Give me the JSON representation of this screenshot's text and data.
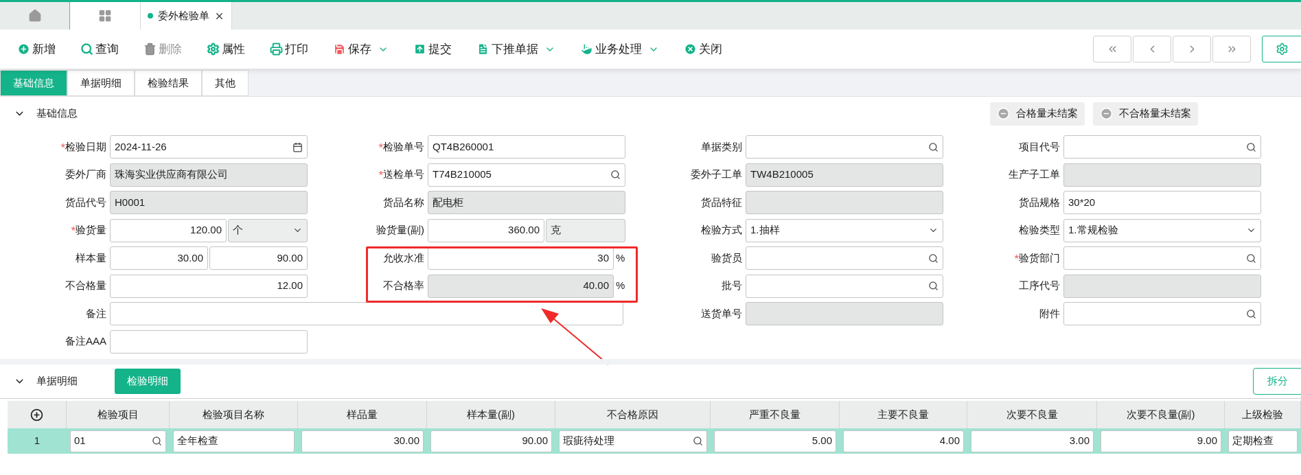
{
  "window_tabs": [
    {
      "kind": "home",
      "selected": false
    },
    {
      "kind": "apps",
      "selected": false
    },
    {
      "kind": "document",
      "label": "委外检验单",
      "selected": true
    }
  ],
  "toolbar": [
    {
      "kind": "add",
      "label": "新增",
      "disabled": false,
      "has_menu": false
    },
    {
      "kind": "query",
      "label": "查询",
      "disabled": false,
      "has_menu": false
    },
    {
      "kind": "delete",
      "label": "删除",
      "disabled": true,
      "has_menu": false
    },
    {
      "kind": "properties",
      "label": "属性",
      "disabled": false,
      "has_menu": false
    },
    {
      "kind": "print",
      "label": "打印",
      "disabled": false,
      "has_menu": false
    },
    {
      "kind": "save",
      "label": "保存",
      "disabled": false,
      "has_menu": true
    },
    {
      "kind": "submit",
      "label": "提交",
      "disabled": false,
      "has_menu": false
    },
    {
      "kind": "push",
      "label": "下推单据",
      "disabled": false,
      "has_menu": true
    },
    {
      "kind": "process",
      "label": "业务处理",
      "disabled": false,
      "has_menu": true
    },
    {
      "kind": "close",
      "label": "关闭",
      "disabled": false,
      "has_menu": false
    }
  ],
  "sub_tabs": [
    {
      "label": "基础信息",
      "selected": true
    },
    {
      "label": "单据明细",
      "selected": false
    },
    {
      "label": "检验结果",
      "selected": false
    },
    {
      "label": "其他",
      "selected": false
    }
  ],
  "basic_section": {
    "title": "基础信息",
    "expanded": true,
    "status_buttons": [
      "合格量未结案",
      "不合格量未结案"
    ],
    "fields": [
      {
        "label": "检验日期",
        "required_mark": "*",
        "kind": "date",
        "value": "2024-11-26",
        "readonly": false
      },
      {
        "label": "检验单号",
        "required_mark": "*",
        "kind": "text",
        "value": "QT4B260001",
        "readonly": false
      },
      {
        "label": "单据类别",
        "kind": "lookup",
        "readonly": false
      },
      {
        "label": "项目代号",
        "kind": "lookup",
        "readonly": false
      },
      {
        "label": "委外厂商",
        "kind": "text",
        "value": "珠海实业供应商有限公司",
        "readonly": true
      },
      {
        "label": "送检单号",
        "required_mark": "*",
        "kind": "lookup",
        "value": "T74B210005",
        "readonly": false
      },
      {
        "label": "委外子工单",
        "kind": "text",
        "value": "TW4B210005",
        "readonly": true
      },
      {
        "label": "生产子工单",
        "kind": "text",
        "readonly": true
      },
      {
        "label": "货品代号",
        "kind": "text",
        "value": "H0001",
        "readonly": true
      },
      {
        "label": "货品名称",
        "kind": "text",
        "value": "配电柜",
        "readonly": true
      },
      {
        "label": "货品特征",
        "kind": "text",
        "readonly": true
      },
      {
        "label": "货品规格",
        "kind": "text",
        "value": "30*20",
        "readonly": false
      },
      {
        "label": "验货量",
        "required_mark": "*",
        "kind": "number_unit_select",
        "value": "120.00",
        "unit": "个",
        "readonly": false
      },
      {
        "label": "验货量(副)",
        "kind": "number_unit",
        "value": "360.00",
        "unit": "克",
        "readonly": false
      },
      {
        "label": "检验方式",
        "kind": "select",
        "value": "1.抽样",
        "readonly": false
      },
      {
        "label": "检验类型",
        "kind": "select",
        "value": "1.常规检验",
        "readonly": false
      },
      {
        "label": "样本量",
        "kind": "number_pair",
        "value": "30.00",
        "value_2": "90.00",
        "readonly": false
      },
      {
        "label": "允收水准",
        "kind": "percent",
        "value": "30",
        "suffix": "%",
        "readonly": false
      },
      {
        "label": "验货员",
        "kind": "lookup",
        "readonly": false
      },
      {
        "label": "验货部门",
        "required_mark": "*",
        "kind": "lookup",
        "readonly": false
      },
      {
        "label": "不合格量",
        "kind": "number",
        "value": "12.00",
        "readonly": false
      },
      {
        "label": "不合格率",
        "kind": "percent",
        "value": "40.00",
        "suffix": "%",
        "readonly": true
      },
      {
        "label": "批号",
        "kind": "lookup",
        "readonly": false
      },
      {
        "label": "工序代号",
        "kind": "text",
        "readonly": true
      },
      {
        "label": "备注",
        "kind": "wide_text",
        "readonly": false
      },
      {
        "label": "送货单号",
        "kind": "text",
        "readonly": true
      },
      {
        "label": "附件",
        "kind": "lookup",
        "readonly": false
      },
      {
        "label": "备注AAA",
        "kind": "text",
        "readonly": false
      }
    ]
  },
  "detail_section": {
    "title": "单据明细",
    "expanded": true,
    "tabs": [
      {
        "label": "检验明细",
        "selected": true
      }
    ],
    "split_button": "拆分",
    "columns": [
      "检验项目",
      "检验项目名称",
      "样品量",
      "样本量(副)",
      "不合格原因",
      "严重不良量",
      "主要不良量",
      "次要不良量",
      "次要不良量(副)",
      "上级检验"
    ],
    "rows": [
      {
        "index": "1",
        "selected": true,
        "cells": [
          {
            "kind": "lookup",
            "value": "01"
          },
          {
            "kind": "text",
            "value": "全年检查"
          },
          {
            "kind": "number",
            "value": "30.00"
          },
          {
            "kind": "number",
            "value": "90.00"
          },
          {
            "kind": "lookup",
            "value": "瑕疵待处理"
          },
          {
            "kind": "number",
            "value": "5.00"
          },
          {
            "kind": "number",
            "value": "4.00"
          },
          {
            "kind": "number",
            "value": "3.00"
          },
          {
            "kind": "number",
            "value": "9.00"
          },
          {
            "kind": "text",
            "value": "定期检查"
          }
        ]
      }
    ]
  }
}
